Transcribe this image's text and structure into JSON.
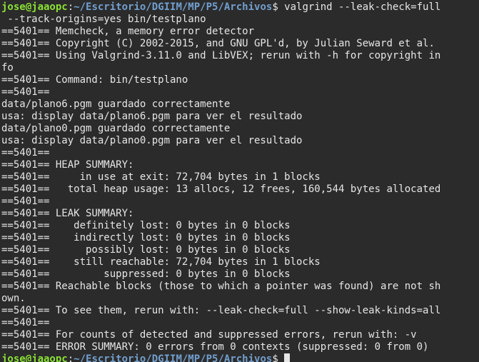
{
  "prompt": {
    "user_host": "jose@jaaopc",
    "separator": ":",
    "path": "~/Escritorio/DGIIM/MP/P5/Archivos",
    "symbol": "$ "
  },
  "command_line_1": "valgrind --leak-check=full",
  "command_line_2": " --track-origins=yes bin/testplano",
  "output_lines": [
    "==5401== Memcheck, a memory error detector",
    "==5401== Copyright (C) 2002-2015, and GNU GPL'd, by Julian Seward et al.",
    "==5401== Using Valgrind-3.11.0 and LibVEX; rerun with -h for copyright in",
    "fo",
    "==5401== Command: bin/testplano",
    "==5401==",
    "data/plano6.pgm guardado correctamente",
    "usa: display data/plano6.pgm para ver el resultado",
    "data/plano0.pgm guardado correctamente",
    "usa: display data/plano0.pgm para ver el resultado",
    "==5401==",
    "==5401== HEAP SUMMARY:",
    "==5401==     in use at exit: 72,704 bytes in 1 blocks",
    "==5401==   total heap usage: 13 allocs, 12 frees, 160,544 bytes allocated",
    "==5401==",
    "==5401== LEAK SUMMARY:",
    "==5401==    definitely lost: 0 bytes in 0 blocks",
    "==5401==    indirectly lost: 0 bytes in 0 blocks",
    "==5401==      possibly lost: 0 bytes in 0 blocks",
    "==5401==    still reachable: 72,704 bytes in 1 blocks",
    "==5401==         suppressed: 0 bytes in 0 blocks",
    "==5401== Reachable blocks (those to which a pointer was found) are not sh",
    "own.",
    "==5401== To see them, rerun with: --leak-check=full --show-leak-kinds=all",
    "==5401==",
    "==5401== For counts of detected and suppressed errors, rerun with: -v",
    "==5401== ERROR SUMMARY: 0 errors from 0 contexts (suppressed: 0 from 0)"
  ],
  "colors": {
    "background": "#2b2b2b",
    "text": "#e6e6e6",
    "user_host": "#8ae234",
    "path": "#729fcf"
  }
}
